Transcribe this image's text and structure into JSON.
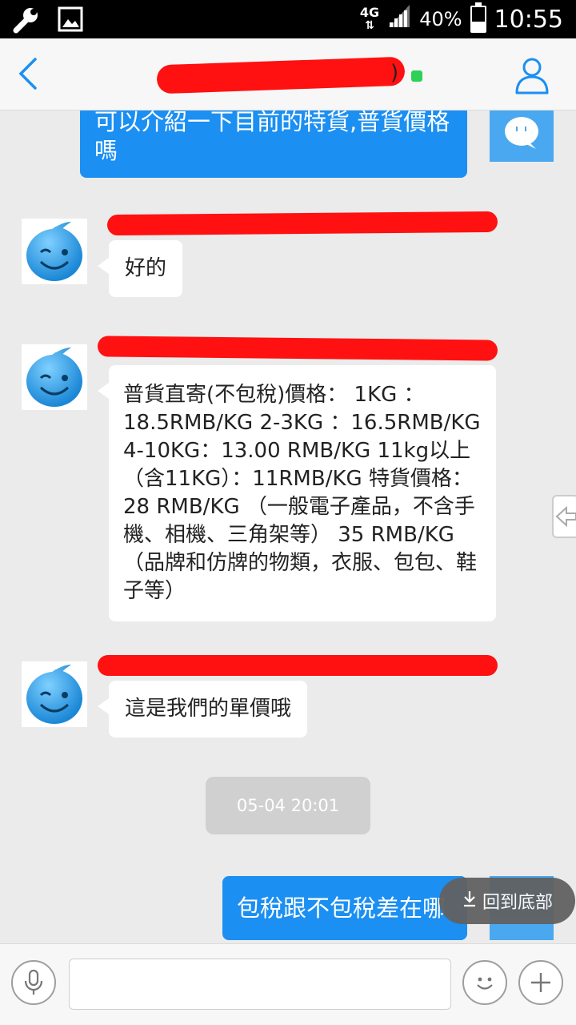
{
  "status_bar": {
    "network": "4G",
    "battery_percent": "40%",
    "battery_level": 0.4,
    "time": "10:55",
    "icons": [
      "wrench-icon",
      "image-icon",
      "signal-icon",
      "battery-icon"
    ]
  },
  "header": {
    "back_icon": "chevron-left-icon",
    "title_suffix": ")",
    "online_status_color": "#2ed158",
    "profile_icon": "user-icon"
  },
  "messages": [
    {
      "direction": "out",
      "text": "可以介紹一下目前的特貨,普貨價格嗎"
    },
    {
      "direction": "in",
      "text": "好的"
    },
    {
      "direction": "in",
      "text": "普貨直寄(不包稅)價格： 1KG ： 18.5RMB/KG 2-3KG ：16.5RMB/KG 4-10KG：13.00 RMB/KG 11kg以上（含11KG）：11RMB/KG 特貨價格： 28 RMB/KG （一般電子產品，不含手機、相機、三角架等） 35 RMB/KG （品牌和仿牌的物類，衣服、包包、鞋子等）"
    },
    {
      "direction": "in",
      "text": "這是我們的單價哦"
    },
    {
      "direction": "out",
      "text": "包稅跟不包稅差在哪"
    }
  ],
  "timestamp": "05-04 20:01",
  "scroll_to_bottom": {
    "icon": "arrow-down-icon",
    "label": "回到底部"
  },
  "input_bar": {
    "voice_icon": "microphone-icon",
    "emoji_icon": "smiley-icon",
    "add_icon": "plus-icon",
    "placeholder": ""
  },
  "colors": {
    "accent": "#1b8ff2",
    "redaction": "#ff1111",
    "background": "#ebebeb"
  }
}
